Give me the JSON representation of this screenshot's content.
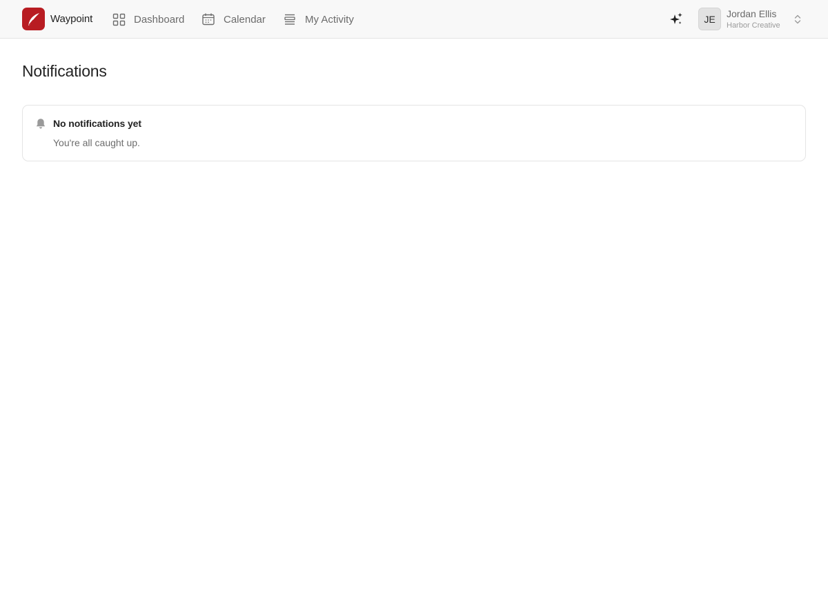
{
  "app": {
    "name": "Waypoint",
    "accent_color": "#b81c22"
  },
  "nav": {
    "items": [
      {
        "label": "Dashboard",
        "icon": "grid-icon"
      },
      {
        "label": "Calendar",
        "icon": "calendar-icon"
      },
      {
        "label": "My Activity",
        "icon": "list-icon"
      }
    ]
  },
  "header": {
    "assistant_icon": "sparkle-icon",
    "user": {
      "initials": "JE",
      "name": "Jordan Ellis",
      "organization": "Harbor Creative",
      "switch_icon": "chevron-up-down-icon"
    }
  },
  "main": {
    "title": "Notifications",
    "empty_state": {
      "icon": "bell-icon",
      "title": "No notifications yet",
      "message": "You're all caught up."
    }
  }
}
